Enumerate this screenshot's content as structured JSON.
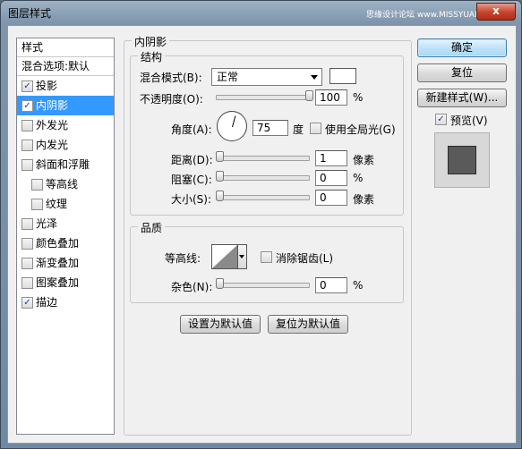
{
  "window": {
    "title": "图层样式",
    "watermark": "思缘设计论坛 www.MISSYUAN.COM",
    "close_glyph": "x"
  },
  "style_list": {
    "header": "样式",
    "blend_options": "混合选项:默认",
    "items": [
      {
        "label": "投影",
        "checked": true,
        "checkmark": "✓"
      },
      {
        "label": "内阴影",
        "checked": true,
        "checkmark": "✓",
        "selected": true
      },
      {
        "label": "外发光",
        "checked": false,
        "checkmark": ""
      },
      {
        "label": "内发光",
        "checked": false,
        "checkmark": ""
      },
      {
        "label": "斜面和浮雕",
        "checked": false,
        "checkmark": ""
      },
      {
        "label": "等高线",
        "checked": false,
        "checkmark": "",
        "sub": true
      },
      {
        "label": "纹理",
        "checked": false,
        "checkmark": "",
        "sub": true
      },
      {
        "label": "光泽",
        "checked": false,
        "checkmark": ""
      },
      {
        "label": "颜色叠加",
        "checked": false,
        "checkmark": ""
      },
      {
        "label": "渐变叠加",
        "checked": false,
        "checkmark": ""
      },
      {
        "label": "图案叠加",
        "checked": false,
        "checkmark": ""
      },
      {
        "label": "描边",
        "checked": true,
        "checkmark": "✓"
      }
    ]
  },
  "inner_shadow": {
    "title": "内阴影",
    "structure": {
      "title": "结构",
      "blend_mode_label": "混合模式(B):",
      "blend_mode_value": "正常",
      "shadow_color": "#ffffff",
      "opacity_label": "不透明度(O):",
      "opacity_value": "100",
      "opacity_unit": "%",
      "opacity_fraction": 1.0,
      "angle_label": "角度(A):",
      "angle_value": "75",
      "angle_unit": "度",
      "global_light_label": "使用全局光(G)",
      "global_light_checked": false,
      "distance_label": "距离(D):",
      "distance_value": "1",
      "distance_unit": "像素",
      "choke_label": "阻塞(C):",
      "choke_value": "0",
      "choke_unit": "%",
      "size_label": "大小(S):",
      "size_value": "0",
      "size_unit": "像素"
    },
    "quality": {
      "title": "品质",
      "contour_label": "等高线:",
      "anti_alias_label": "消除锯齿(L)",
      "anti_alias_checked": false,
      "noise_label": "杂色(N):",
      "noise_value": "0",
      "noise_unit": "%"
    },
    "set_default_button": "设置为默认值",
    "reset_default_button": "复位为默认值"
  },
  "buttons": {
    "ok": "确定",
    "reset": "复位",
    "new_style": "新建样式(W)...",
    "preview_label": "预览(V)",
    "preview_checked": true,
    "preview_checkmark": "✓"
  },
  "colors": {
    "selection": "#3399ff",
    "preview_swatch": "#5a5a5a"
  }
}
